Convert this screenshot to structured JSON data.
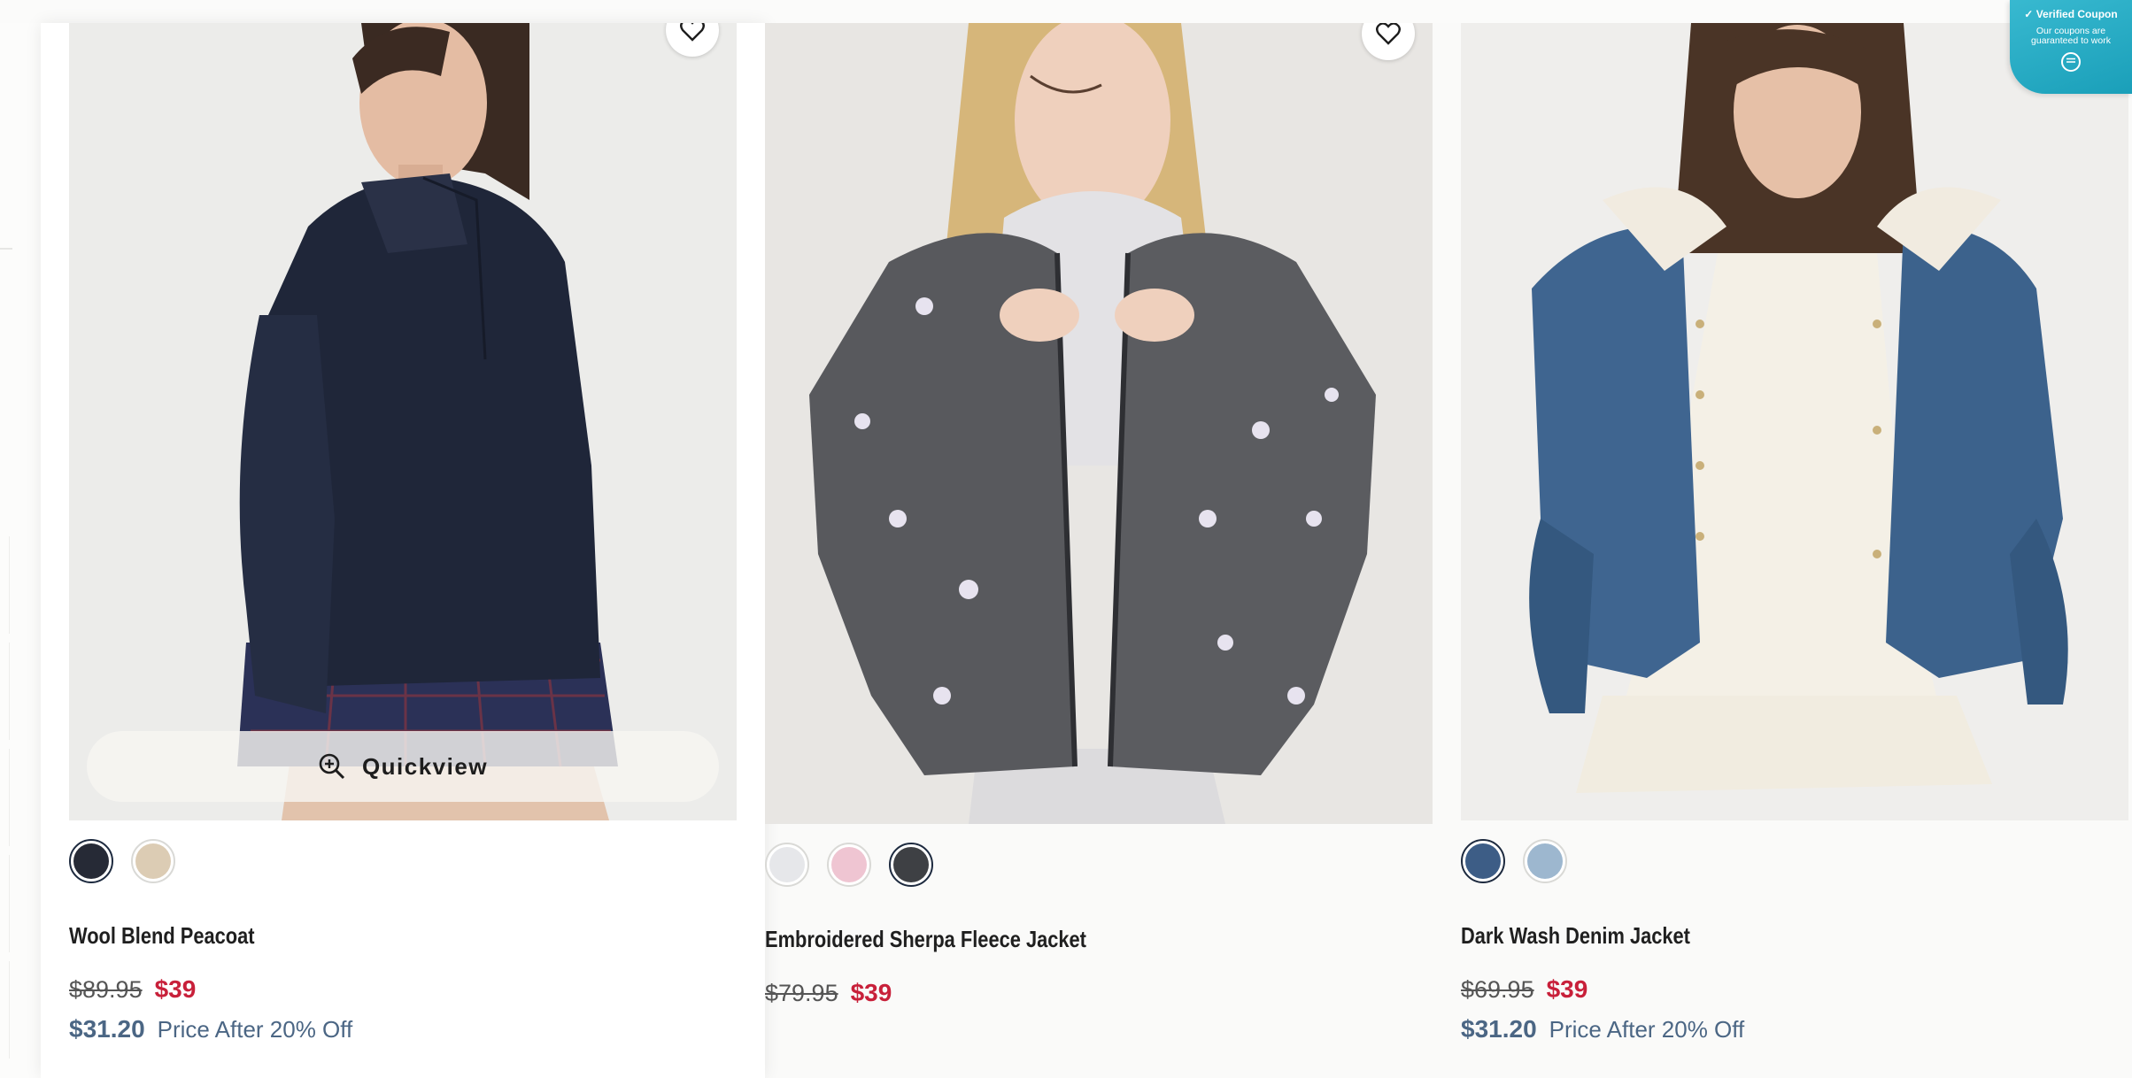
{
  "coupon_badge": {
    "title": "Verified Coupon",
    "text": "Our coupons are guaranteed to work",
    "color": "#2ab0c8"
  },
  "quickview": {
    "label": "Quickview"
  },
  "products": [
    {
      "name": "Wool Blend Peacoat",
      "original_price": "$89.95",
      "sale_price": "$39",
      "after_discount_price": "$31.20",
      "after_discount_label": "Price After 20% Off",
      "swatches": [
        {
          "color": "#262a36",
          "selected": true
        },
        {
          "color": "#dcccb4",
          "selected": false
        }
      ]
    },
    {
      "name": "Embroidered Sherpa Fleece Jacket",
      "original_price": "$79.95",
      "sale_price": "$39",
      "swatches": [
        {
          "color": "#e6e7ea",
          "selected": false
        },
        {
          "color": "#efc5d2",
          "selected": false
        },
        {
          "color": "#3e4044",
          "selected": true
        }
      ]
    },
    {
      "name": "Dark Wash Denim Jacket",
      "original_price": "$69.95",
      "sale_price": "$39",
      "after_discount_price": "$31.20",
      "after_discount_label": "Price After 20% Off",
      "swatches": [
        {
          "color": "#3d5d86",
          "selected": true
        },
        {
          "color": "#9db7cf",
          "selected": false
        }
      ]
    }
  ]
}
